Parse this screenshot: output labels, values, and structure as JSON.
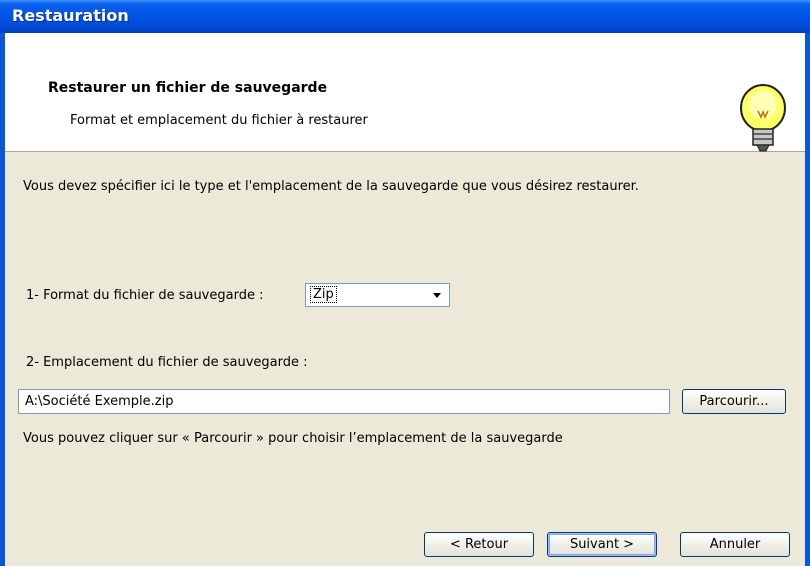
{
  "window": {
    "title": "Restauration"
  },
  "header": {
    "title": "Restaurer un fichier de sauvegarde",
    "subtitle": "Format et emplacement du fichier à restaurer",
    "icon": "lightbulb-icon"
  },
  "intro": "Vous devez spécifier ici le type et l'emplacement de la sauvegarde que vous désirez restaurer.",
  "format": {
    "label": "1- Format du fichier de sauvegarde :",
    "selected": "Zip"
  },
  "location": {
    "label": "2- Emplacement du fichier de sauvegarde :",
    "value": "A:\\Société Exemple.zip",
    "browse_label": "Parcourir...",
    "hint": "Vous pouvez cliquer sur « Parcourir » pour choisir l’emplacement de la sauvegarde"
  },
  "buttons": {
    "back": "< Retour",
    "next": "Suivant >",
    "cancel": "Annuler"
  }
}
